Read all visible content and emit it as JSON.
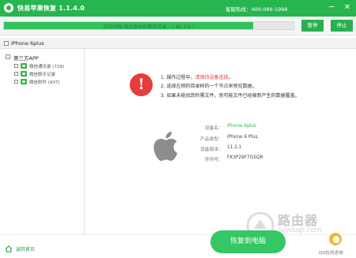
{
  "app": {
    "title": "快易苹果恢复 1.1.4.0",
    "hotline": "客服热线：400-089-1998",
    "minimize_label": "─",
    "close_label": "✕"
  },
  "progress": {
    "text": "正在扫描 微信备份的聊天记录... ( 86.1% )",
    "percent": 86.1,
    "pause_label": "暂停",
    "stop_label": "停止"
  },
  "device": {
    "name": "iPhone 6plus"
  },
  "sidebar": {
    "root_label": "第三方APP",
    "items": [
      {
        "label": "微信通讯录 (729)"
      },
      {
        "label": "微信聊天记录"
      },
      {
        "label": "微信附件 (937)"
      }
    ]
  },
  "notice": {
    "line1_prefix": "1. 操作过程中，",
    "line1_warn": "请保持设备连接",
    "line1_suffix": "。",
    "line2": "2. 选择左侧的目录树的一个节点来预览数据。",
    "line3": "3. 如果未能找到所需文件，则可能文件已经被新产生的数据覆盖。"
  },
  "device_info": {
    "rows": [
      {
        "label": "设备名：",
        "value": "iPhone 6plus"
      },
      {
        "label": "产品类型：",
        "value": "iPhone 6 Plus"
      },
      {
        "label": "设备版本：",
        "value": "11.1.1"
      },
      {
        "label": "序列号：",
        "value": "FK3P29F7G5QR"
      }
    ]
  },
  "footer": {
    "home_label": "返回首页",
    "recover_label": "恢复到电脑",
    "qq_label": "QQ在线咨询"
  },
  "watermark": {
    "title": "路由器",
    "subtitle": "luyouqi.com"
  },
  "colors": {
    "brand_green": "#27b54f",
    "button_green": "#35c763",
    "warn_red": "#e33b3b",
    "alert_red": "#e83b3b"
  },
  "icons": {
    "app": "app-logo-icon",
    "alert": "exclamation-icon",
    "device": "apple-logo-icon",
    "home": "home-icon",
    "qq": "qq-avatar-icon"
  }
}
